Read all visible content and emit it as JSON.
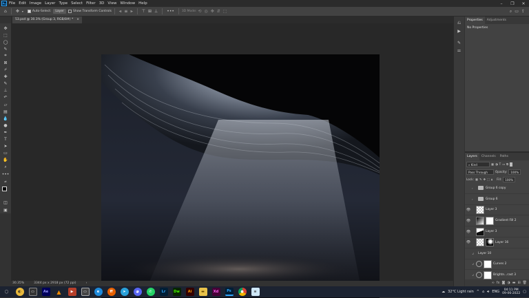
{
  "menu": {
    "app_icon": "Ps",
    "items": [
      "File",
      "Edit",
      "Image",
      "Layer",
      "Type",
      "Select",
      "Filter",
      "3D",
      "View",
      "Window",
      "Help"
    ]
  },
  "options_bar": {
    "auto_select_label": "Auto-Select:",
    "auto_select_value": "Layer",
    "transform_controls_label": "Show Transform Controls",
    "mode_3d_label": "3D Mode:"
  },
  "document": {
    "tab_title": "53.psd @ 30.3% (Group 3, RGB/8#) *",
    "close_label": "×"
  },
  "status": {
    "zoom": "30.35%",
    "dimensions": "3344 px x 2918 px (72 ppi)"
  },
  "properties": {
    "tabs": [
      "Properties",
      "Adjustments"
    ],
    "empty_text": "No Properties"
  },
  "layers_panel": {
    "tabs": [
      "Layers",
      "Channels",
      "Paths"
    ],
    "filter_label": "Kind",
    "blend_mode": "Pass Through",
    "opacity_label": "Opacity:",
    "opacity_value": "100%",
    "lock_label": "Lock:",
    "fill_label": "Fill:",
    "fill_value": "100%",
    "layers": [
      {
        "name": "Group 6 copy",
        "kind": "group",
        "visible": false
      },
      {
        "name": "Group 6",
        "kind": "group",
        "visible": false
      },
      {
        "name": "Layer 3",
        "kind": "pixel",
        "visible": true
      },
      {
        "name": "Gradient Fill 2",
        "kind": "fill",
        "visible": true
      },
      {
        "name": "Layer 3",
        "kind": "pixel",
        "visible": true
      },
      {
        "name": "Layer 16",
        "kind": "pixel",
        "visible": true
      },
      {
        "name": "Layer 10",
        "kind": "text",
        "visible": false
      },
      {
        "name": "Curves 2",
        "kind": "adjustment",
        "visible": false
      },
      {
        "name": "Brightn...rast 3",
        "kind": "adjustment",
        "visible": false
      }
    ]
  },
  "taskbar": {
    "weather": "32°C  Light rain",
    "language": "ENG",
    "time": "04:11 PM",
    "date": "09-06-2022",
    "apps": [
      "start",
      "search",
      "files",
      "Ae",
      "vlc",
      "media",
      "video",
      "edge",
      "firefox",
      "telegram",
      "discord",
      "whatsapp",
      "Lr",
      "Dw",
      "Ai",
      "folder",
      "Xd",
      "Ps",
      "chrome",
      "notepad"
    ]
  },
  "colors": {
    "accent": "#31a8ff",
    "panel": "#424242",
    "workspace": "#282828"
  }
}
